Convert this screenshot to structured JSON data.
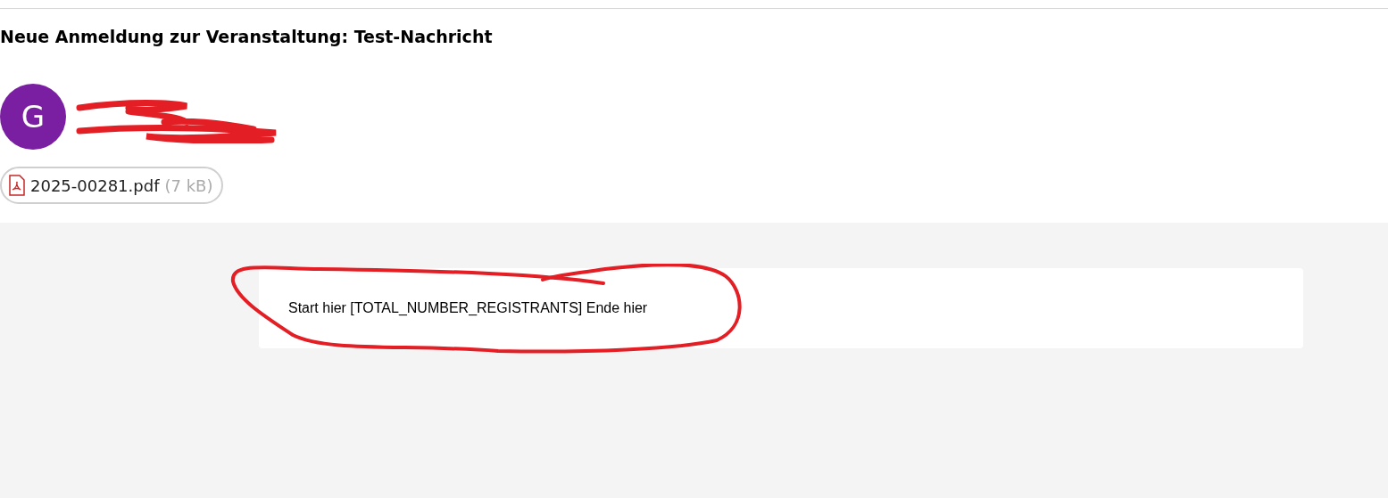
{
  "subject": "Neue Anmeldung zur Veranstaltung: Test-Nachricht",
  "sender": {
    "initial": "G",
    "color": "#7b1fa2"
  },
  "attachments": [
    {
      "name": "2025-00281.pdf",
      "size": "(7 kB)"
    }
  ],
  "body": {
    "text": "Start hier [TOTAL_NUMBER_REGISTRANTS] Ende hier"
  }
}
